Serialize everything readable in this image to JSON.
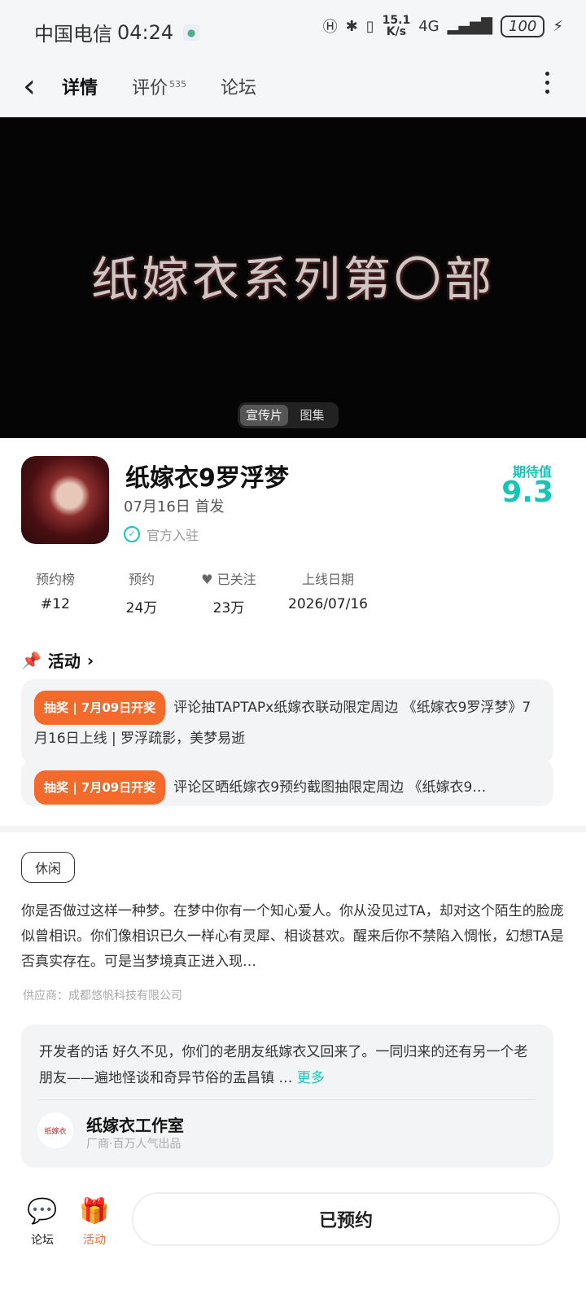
{
  "status_bar": {
    "carrier": "中国电信",
    "time": "04:24",
    "net_speed": "15.1",
    "net_speed_unit": "K/s",
    "network": "4G",
    "battery": "100"
  },
  "nav": {
    "tabs": [
      {
        "label": "详情"
      },
      {
        "label": "评价",
        "count": "535"
      },
      {
        "label": "论坛"
      }
    ]
  },
  "banner": {
    "title": "纸嫁衣系列第〇部",
    "switch": [
      "宣传片",
      "图集"
    ]
  },
  "app": {
    "name": "纸嫁衣9罗浮梦",
    "release": "07月16日 首发",
    "official": "官方入驻",
    "score_label": "期待值",
    "score": "9.3"
  },
  "stats": [
    {
      "label": "预约榜",
      "value": "#12"
    },
    {
      "label": "预约",
      "value": "24万"
    },
    {
      "label": "已关注",
      "value": "23万"
    },
    {
      "label": "上线日期",
      "value": "2026/07/16"
    }
  ],
  "activities": {
    "heading": "活动",
    "items": [
      {
        "tag": "抽奖 | 7月09日开奖",
        "text": "评论抽TAPTAPx纸嫁衣联动限定周边 《纸嫁衣9罗浮梦》7月16日上线 | 罗浮疏影，美梦易逝"
      },
      {
        "tag": "抽奖 | 7月09日开奖",
        "text": "评论区晒纸嫁衣9预约截图抽限定周边 《纸嫁衣9…"
      }
    ]
  },
  "about": {
    "tag": "休闲",
    "description": "你是否做过这样一种梦。在梦中你有一个知心爱人。你从没见过TA，却对这个陌生的脸庞似曾相识。你们像相识已久一样心有灵犀、相谈甚欢。醒来后你不禁陷入惆怅，幻想TA是否真实存在。可是当梦境真正进入现…",
    "supplier": "供应商：成都悠帆科技有限公司"
  },
  "developer": {
    "lead": "开发者的话",
    "text": "开发者的话 好久不见，你们的老朋友纸嫁衣又回来了。一同归来的还有另一个老朋友——遍地怪谈和奇异节俗的盂昌镇 …",
    "more": "更多",
    "studio_name": "纸嫁衣工作室",
    "studio_sub": "厂商·百万人气出品",
    "studio_avatar_text": "纸嫁衣"
  },
  "bottom": {
    "forum": "论坛",
    "activity": "活动",
    "install": "已预约"
  },
  "colors": {
    "accent": "#15c5b7",
    "orange": "#f46a2a",
    "banner_bg": "#050505"
  }
}
